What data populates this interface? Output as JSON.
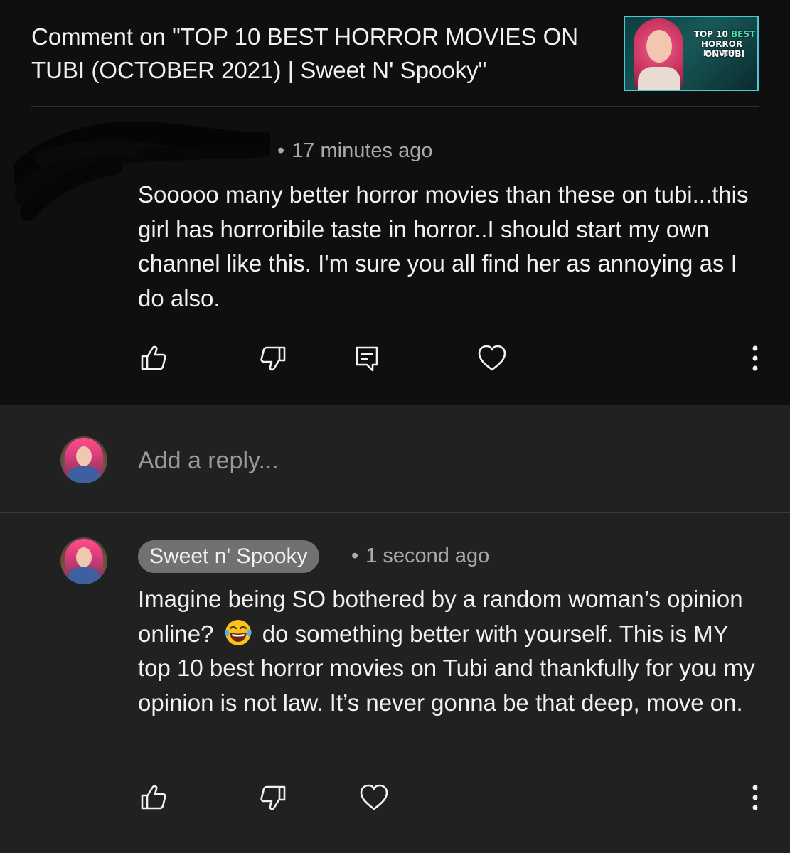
{
  "header": {
    "title": "Comment on \"TOP 10 BEST HORROR MOVIES ON TUBI (OCTOBER 2021) | Sweet N' Spooky\"",
    "thumbnail": {
      "line1_a": "TOP 10 ",
      "line1_b": "BEST",
      "line2": "HORROR MOVIES",
      "line3": "ON TUBI"
    }
  },
  "original_comment": {
    "dot": "•",
    "timestamp": "17 minutes ago",
    "text": "Sooooo many better horror movies than these on tubi...this girl has horroribile taste in horror..I should start my own channel like this. I'm sure you all find her as annoying as I do also."
  },
  "reply_bar": {
    "placeholder": "Add a reply..."
  },
  "creator_reply": {
    "author": "Sweet n' Spooky",
    "dot": "•",
    "timestamp": "1 second ago",
    "text_before_emoji": "Imagine being SO bothered by a random woman’s opinion online?",
    "text_after_emoji": "do something better with yourself. This is MY top 10 best horror movies on Tubi and thankfully for you my opinion is not law. It’s never gonna be that deep, move on."
  },
  "icons": {
    "like": "thumbs-up-icon",
    "dislike": "thumbs-down-icon",
    "reply": "comment-icon",
    "heart": "heart-icon",
    "more": "more-vertical-icon",
    "emoji": "laughing-tears-emoji-icon"
  },
  "colors": {
    "page_background": "#0f0f0f",
    "reply_background": "#212121",
    "thumbnail_border": "#4fc6d6",
    "badge_background": "#717171",
    "secondary_text": "#aaaaaa"
  }
}
